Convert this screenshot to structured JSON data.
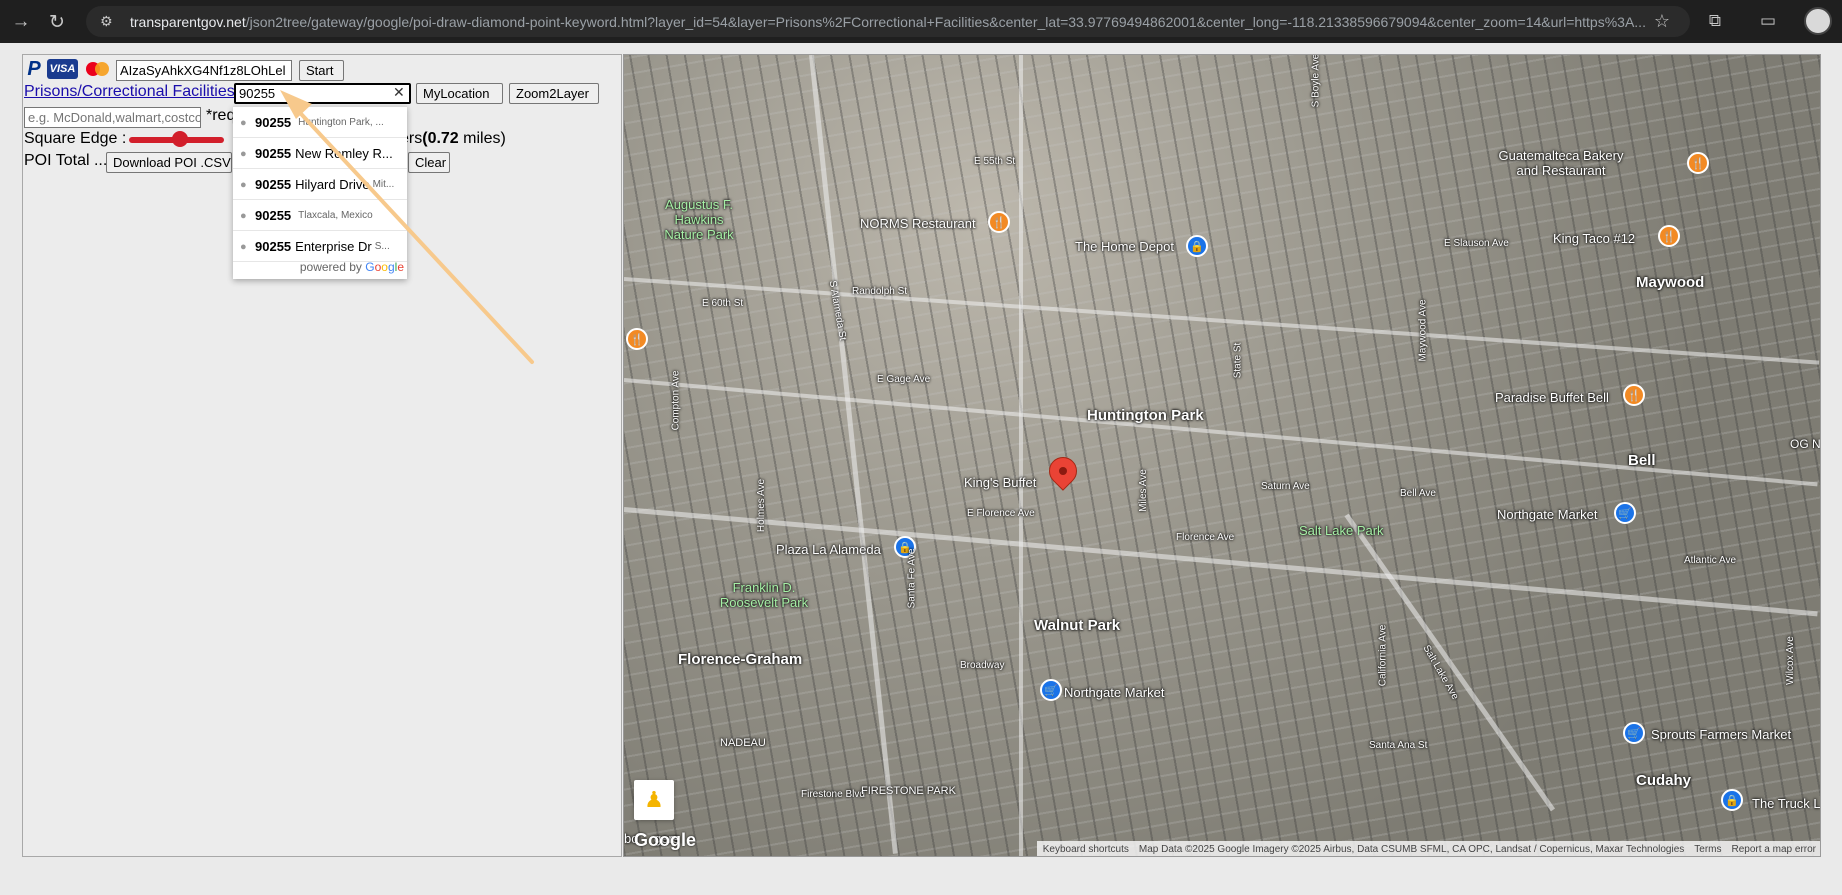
{
  "browser": {
    "url_host": "transparentgov.net",
    "url_rest": "/json2tree/gateway/google/poi-draw-diamond-point-keyword.html?layer_id=54&layer=Prisons%2FCorrectional+Facilities&center_lat=33.97769494862001&center_long=-118.21338596679094&center_zoom=14&url=https%3A..."
  },
  "panel": {
    "api_key_value": "AIzaSyAhkXG4Nf1z8LOhLel",
    "start_label": "Start",
    "layer_link": "Prisons/Correctional Facilities",
    "zip_value": "90255",
    "mylocation_label": "MyLocation",
    "zoom2layer_label": "Zoom2Layer",
    "keyword_placeholder": "e.g. McDonald,walmart,costco",
    "required_note": "*req",
    "square_edge_label": "Square Edge :",
    "edge_value_prefix": "ers",
    "edge_value_bold": "(0.72",
    "edge_value_suffix": " miles)",
    "poi_total_label": "POI Total ...",
    "download_csv_label": "Download POI .CSV",
    "clear_label": "Clear"
  },
  "autocomplete": {
    "items": [
      {
        "main": "90255",
        "name": "",
        "sub": "Huntington Park, ..."
      },
      {
        "main": "90255",
        "name": "New Romley R...",
        "sub": ""
      },
      {
        "main": "90255",
        "name": "Hilyard Drive",
        "sub": "Mit..."
      },
      {
        "main": "90255",
        "name": "",
        "sub": "Tlaxcala, Mexico"
      },
      {
        "main": "90255",
        "name": "Enterprise Dr",
        "sub": "S..."
      }
    ],
    "powered_by": "powered by"
  },
  "map": {
    "cities": [
      "Huntington Park",
      "Walnut Park",
      "Florence-Graham",
      "Maywood",
      "Bell",
      "Cudahy"
    ],
    "places": [
      "Guatemalteca Bakery and Restaurant",
      "NORMS Restaurant",
      "The Home Depot",
      "King Taco #12",
      "Paradise Buffet Bell",
      "King's Buffet",
      "Northgate Market",
      "Plaza La Alameda",
      "Northgate Market",
      "Sprouts Farmers Market",
      "The Truck L"
    ],
    "parks": [
      "Augustus F. Hawkins Nature Park",
      "Salt Lake Park",
      "Franklin D. Roosevelt Park"
    ],
    "streets": [
      "E 55th St",
      "E 60th St",
      "Randolph St",
      "E Gage Ave",
      "E Slauson Ave",
      "E Florence Ave",
      "Florence Ave",
      "Saturn Ave",
      "Bell Ave",
      "Broadway",
      "Firestone Blvd",
      "Santa Ana St",
      "Atlantic Ave",
      "S Alameda St",
      "Compton Ave",
      "Holmes Ave",
      "Miles Ave",
      "State St",
      "California Ave",
      "Salt Lake Ave",
      "Wilcox Ave",
      "Maywood Ave",
      "Santa Fe Ave",
      "S Boyle Ave"
    ],
    "small_labels": [
      "NADEAU",
      "FIRESTONE PARK",
      "OG NA",
      "bo",
      "gers"
    ],
    "footer": [
      "Keyboard shortcuts",
      "Map Data ©2025 Google Imagery ©2025 Airbus, Data CSUMB SFML, CA OPC, Landsat / Copernicus, Maxar Technologies",
      "Terms",
      "Report a map error"
    ],
    "google_logo": "Google"
  }
}
